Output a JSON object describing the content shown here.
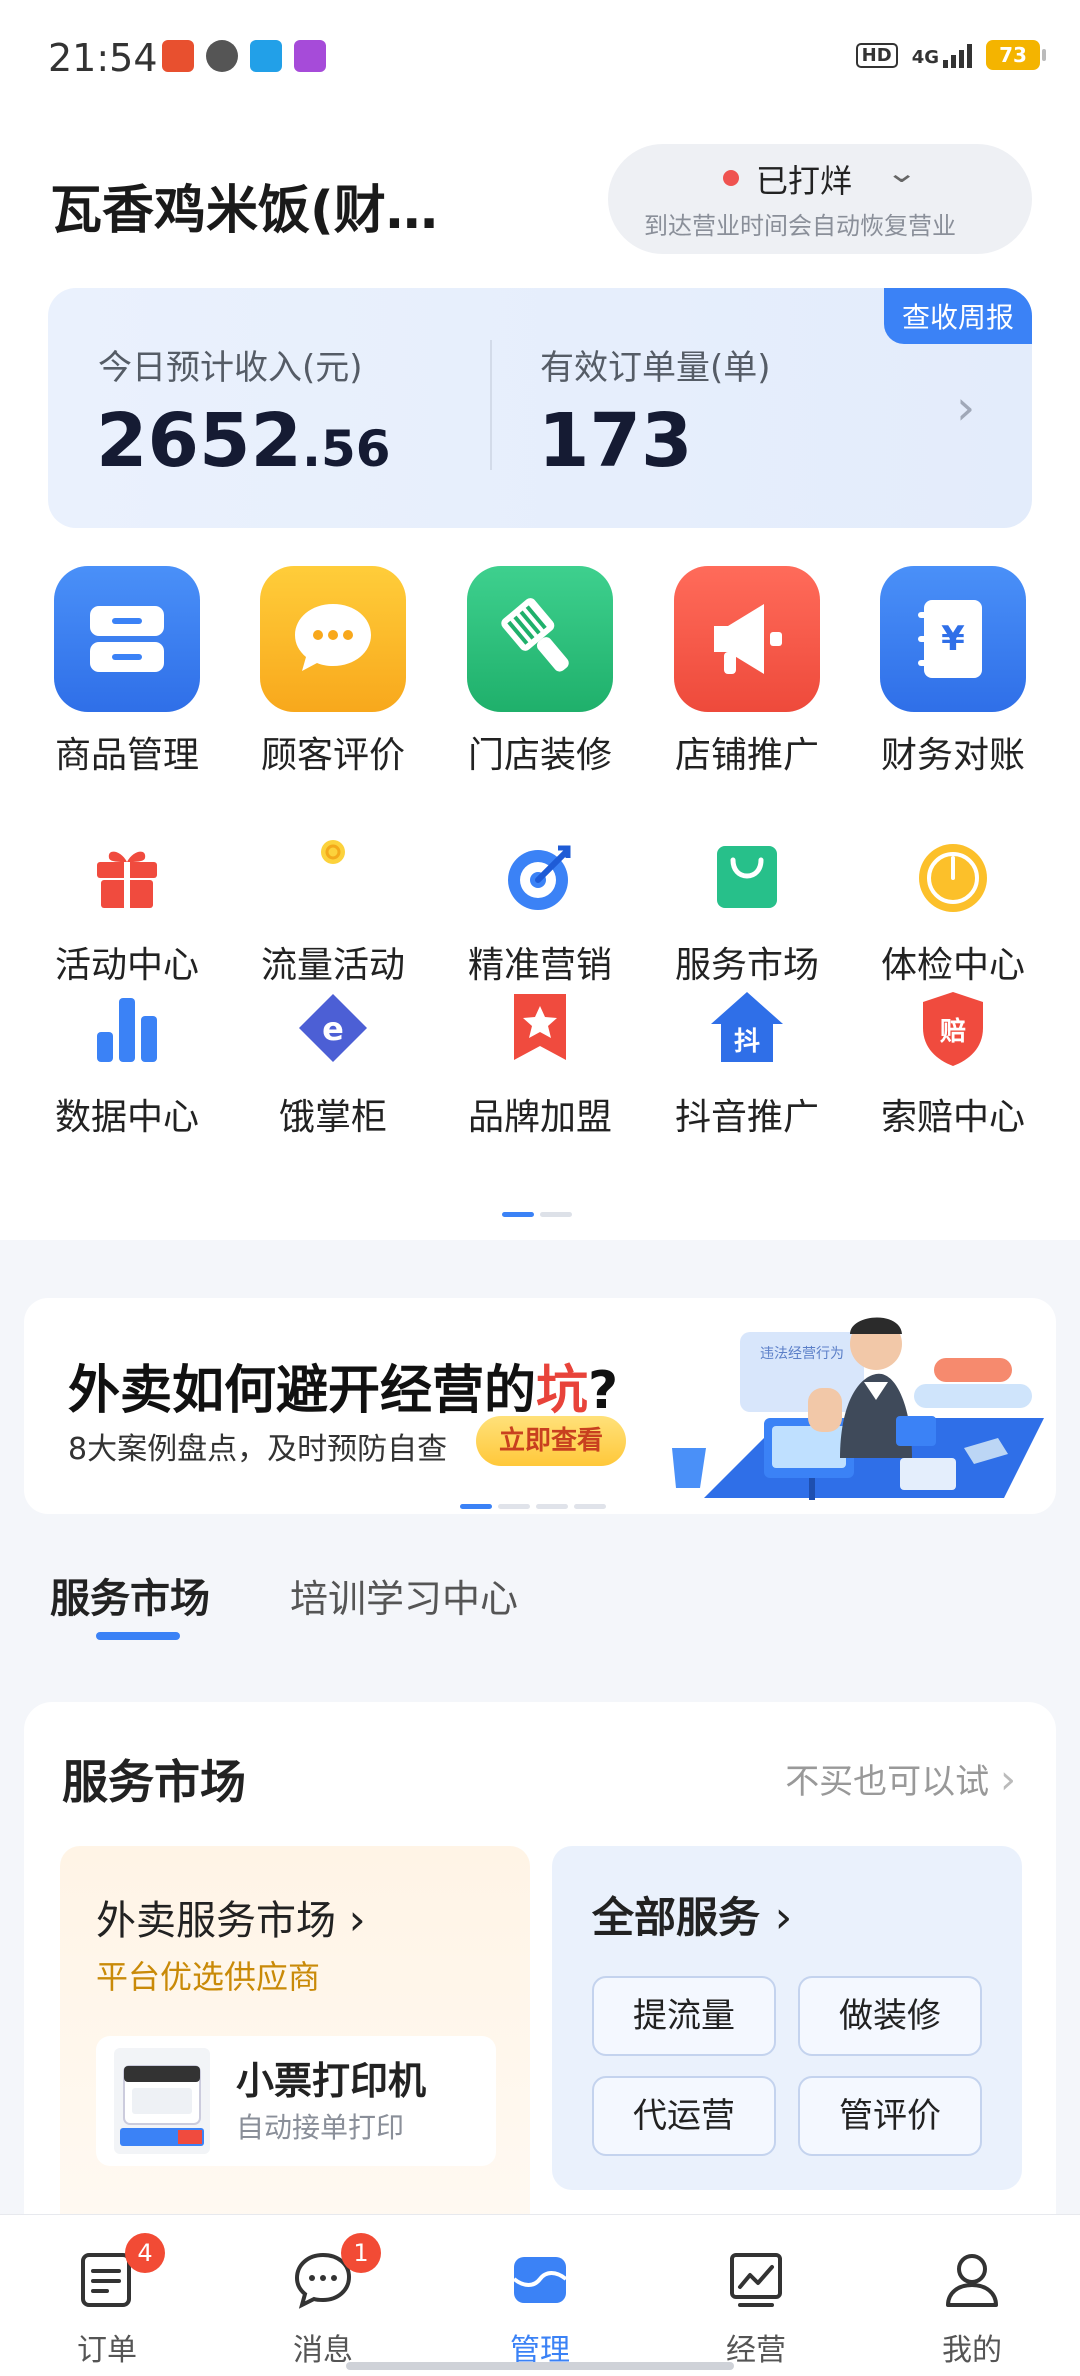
{
  "status_bar": {
    "time": "21:54",
    "hd": "HD",
    "network": "4G",
    "battery": "73"
  },
  "header": {
    "shop_name": "瓦香鸡米饭(财…",
    "status": "已打烊",
    "status_note": "到达营业时间会自动恢复营业"
  },
  "income_card": {
    "tag": "查收周报",
    "income_label": "今日预计收入(元)",
    "income_int": "2652",
    "income_dec": ".56",
    "orders_label": "有效订单量(单)",
    "orders_value": "173"
  },
  "main_tools": [
    {
      "label": "商品管理",
      "icon": "product-drawer-icon",
      "color": "#3b82f6"
    },
    {
      "label": "顾客评价",
      "icon": "chat-bubble-icon",
      "color": "#fbbd1f"
    },
    {
      "label": "门店装修",
      "icon": "paint-brush-icon",
      "color": "#2ec27e"
    },
    {
      "label": "店铺推广",
      "icon": "megaphone-icon",
      "color": "#f35a4a"
    },
    {
      "label": "财务对账",
      "icon": "yuan-ledger-icon",
      "color": "#3b82f6"
    }
  ],
  "sub_tools_row1": [
    {
      "label": "活动中心",
      "icon": "gift-icon"
    },
    {
      "label": "流量活动",
      "icon": "coin-icon"
    },
    {
      "label": "精准营销",
      "icon": "target-icon"
    },
    {
      "label": "服务市场",
      "icon": "shopping-bag-icon"
    },
    {
      "label": "体检中心",
      "icon": "gauge-icon"
    }
  ],
  "sub_tools_row2": [
    {
      "label": "数据中心",
      "icon": "bar-chart-icon"
    },
    {
      "label": "饿掌柜",
      "icon": "eleme-logo-icon"
    },
    {
      "label": "品牌加盟",
      "icon": "star-bookmark-icon"
    },
    {
      "label": "抖音推广",
      "icon": "douyin-house-icon",
      "glyph": "抖"
    },
    {
      "label": "索赔中心",
      "icon": "claim-shield-icon",
      "glyph": "赔"
    }
  ],
  "banner": {
    "title_pre": "外卖如何避开经营的",
    "title_hl": "坑",
    "title_post": "?",
    "subtitle": "8大案例盘点，及时预防自查",
    "button": "立即查看",
    "illustration_tag": "违法经营行为"
  },
  "tabs": [
    {
      "label": "服务市场",
      "active": true
    },
    {
      "label": "培训学习中心",
      "active": false
    }
  ],
  "market": {
    "title": "服务市场",
    "more": "不买也可以试",
    "left_panel": {
      "title": "外卖服务市场",
      "subtitle": "平台优选供应商",
      "product_title": "小票打印机",
      "product_sub": "自动接单打印"
    },
    "right_panel": {
      "title": "全部服务",
      "buttons": [
        "提流量",
        "做装修",
        "代运营",
        "管评价"
      ]
    }
  },
  "bottom_nav": [
    {
      "label": "订单",
      "icon": "order-doc-icon",
      "badge": "4"
    },
    {
      "label": "消息",
      "icon": "message-icon",
      "badge": "1"
    },
    {
      "label": "管理",
      "icon": "manage-icon",
      "active": true
    },
    {
      "label": "经营",
      "icon": "trend-chart-icon"
    },
    {
      "label": "我的",
      "icon": "profile-icon"
    }
  ],
  "colors": {
    "accent": "#3b82f6",
    "badge": "#f24b35",
    "highlight": "#e8433a"
  }
}
